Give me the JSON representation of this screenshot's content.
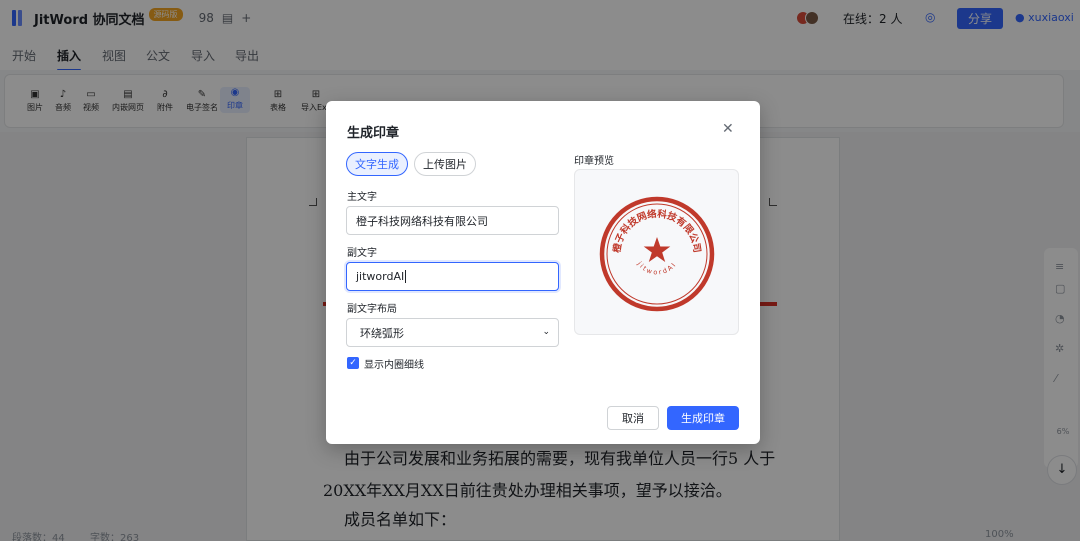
{
  "header": {
    "app_title": "JitWord 协同文档",
    "badge": "源码版",
    "doc_count": "98",
    "online_label": "在线：2 人",
    "share_label": "分享",
    "username": "xuxiaoxi"
  },
  "menu": {
    "tabs": [
      {
        "label": "开始",
        "active": false
      },
      {
        "label": "插入",
        "active": true
      },
      {
        "label": "视图",
        "active": false
      },
      {
        "label": "公文",
        "active": false
      },
      {
        "label": "导入",
        "active": false
      },
      {
        "label": "导出",
        "active": false
      }
    ]
  },
  "toolbar": {
    "items": [
      {
        "icon": "image-icon",
        "label": "图片"
      },
      {
        "icon": "music-icon",
        "label": "音频"
      },
      {
        "icon": "video-icon",
        "label": "视频"
      },
      {
        "icon": "webpage-icon",
        "label": "内嵌网页"
      },
      {
        "icon": "attachment-icon",
        "label": "附件"
      },
      {
        "icon": "signature-icon",
        "label": "电子签名"
      },
      {
        "icon": "seal-icon",
        "label": "印章",
        "active": true
      },
      {
        "icon": "table-icon",
        "label": "表格"
      },
      {
        "icon": "import-excel-icon",
        "label": "导入Exc"
      }
    ]
  },
  "document": {
    "lines": [
      "由于公司发展和业务拓展的需要，现有我单位人员一行5 人于",
      "20XX年XX月XX日前往贵处办理相关事项，望予以接洽。",
      "成员名单如下："
    ]
  },
  "dialog": {
    "title": "生成印章",
    "tabs": [
      "文字生成",
      "上传图片"
    ],
    "main_text_label": "主文字",
    "main_text_value": "橙子科技网络科技有限公司",
    "sub_text_label": "副文字",
    "sub_text_value": "jitwordAI",
    "layout_label": "副文字布局",
    "layout_value": "环绕弧形",
    "checkbox_label": "显示内圈细线",
    "checkbox_checked": true,
    "preview_label": "印章预览",
    "cancel_label": "取消",
    "confirm_label": "生成印章"
  },
  "side": {
    "percent": "6%"
  },
  "status": {
    "paragraphs": "段落数：44",
    "chars": "字数：263",
    "zoom": "100%"
  },
  "colors": {
    "accent": "#3366ff",
    "seal_red": "#c0392b"
  }
}
